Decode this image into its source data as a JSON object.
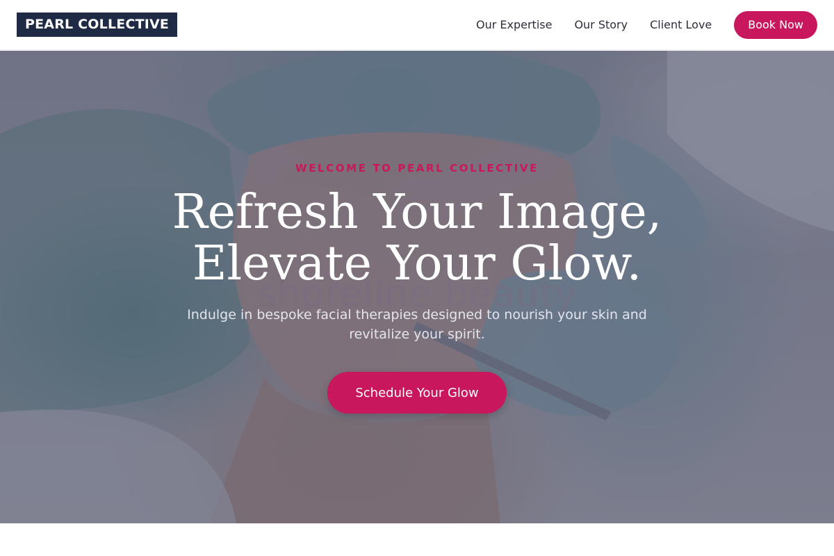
{
  "brand": {
    "name": "PEARL COLLECTIVE"
  },
  "nav": {
    "links": [
      "Our Expertise",
      "Our Story",
      "Client Love"
    ],
    "cta_label": "Book Now"
  },
  "hero": {
    "eyebrow": "WELCOME TO PEARL COLLECTIVE",
    "headline_line1": "Refresh Your Image,",
    "headline_line2": "Elevate Your Glow.",
    "subtitle": "Indulge in bespoke facial therapies designed to nourish your skin and revitalize your spirit.",
    "cta_label": "Schedule Your Glow",
    "watermark": "shoreline.beauty",
    "image_subject": "facial-treatment-photo"
  },
  "colors": {
    "accent": "#c8175d",
    "brand_dark": "#1f2a44",
    "overlay": "#3a405a",
    "nav_text": "#2b2f3a"
  }
}
